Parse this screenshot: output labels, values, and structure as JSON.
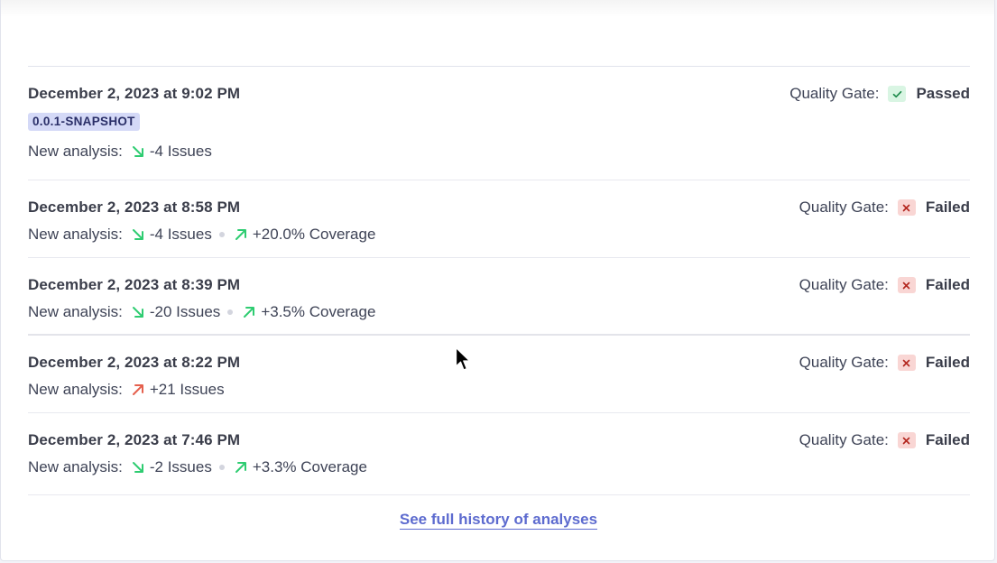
{
  "colors": {
    "down_green": "#2ecc71",
    "up_green": "#2ecc71",
    "up_red": "#e5604d",
    "link": "#5d6bcf"
  },
  "analyses": [
    {
      "date": "December 2, 2023 at 9:02 PM",
      "version": "0.0.1-SNAPSHOT",
      "new_analysis_label": "New analysis:",
      "issues": {
        "text": "-4 Issues",
        "direction": "down",
        "color": "green"
      },
      "coverage": null,
      "gate_label": "Quality Gate:",
      "gate_status": "Passed",
      "gate_icon": "check-icon"
    },
    {
      "date": "December 2, 2023 at 8:58 PM",
      "new_analysis_label": "New analysis:",
      "issues": {
        "text": "-4 Issues",
        "direction": "down",
        "color": "green"
      },
      "coverage": {
        "text": "+20.0% Coverage",
        "direction": "up",
        "color": "green"
      },
      "gate_label": "Quality Gate:",
      "gate_status": "Failed",
      "gate_icon": "x-icon"
    },
    {
      "date": "December 2, 2023 at 8:39 PM",
      "new_analysis_label": "New analysis:",
      "issues": {
        "text": "-20 Issues",
        "direction": "down",
        "color": "green"
      },
      "coverage": {
        "text": "+3.5% Coverage",
        "direction": "up",
        "color": "green"
      },
      "gate_label": "Quality Gate:",
      "gate_status": "Failed",
      "gate_icon": "x-icon"
    },
    {
      "date": "December 2, 2023 at 8:22 PM",
      "new_analysis_label": "New analysis:",
      "issues": {
        "text": "+21 Issues",
        "direction": "up",
        "color": "red"
      },
      "coverage": null,
      "gate_label": "Quality Gate:",
      "gate_status": "Failed",
      "gate_icon": "x-icon"
    },
    {
      "date": "December 2, 2023 at 7:46 PM",
      "new_analysis_label": "New analysis:",
      "issues": {
        "text": "-2 Issues",
        "direction": "down",
        "color": "green"
      },
      "coverage": {
        "text": "+3.3% Coverage",
        "direction": "up",
        "color": "green"
      },
      "gate_label": "Quality Gate:",
      "gate_status": "Failed",
      "gate_icon": "x-icon"
    }
  ],
  "footer": {
    "link_text": "See full history of analyses"
  }
}
